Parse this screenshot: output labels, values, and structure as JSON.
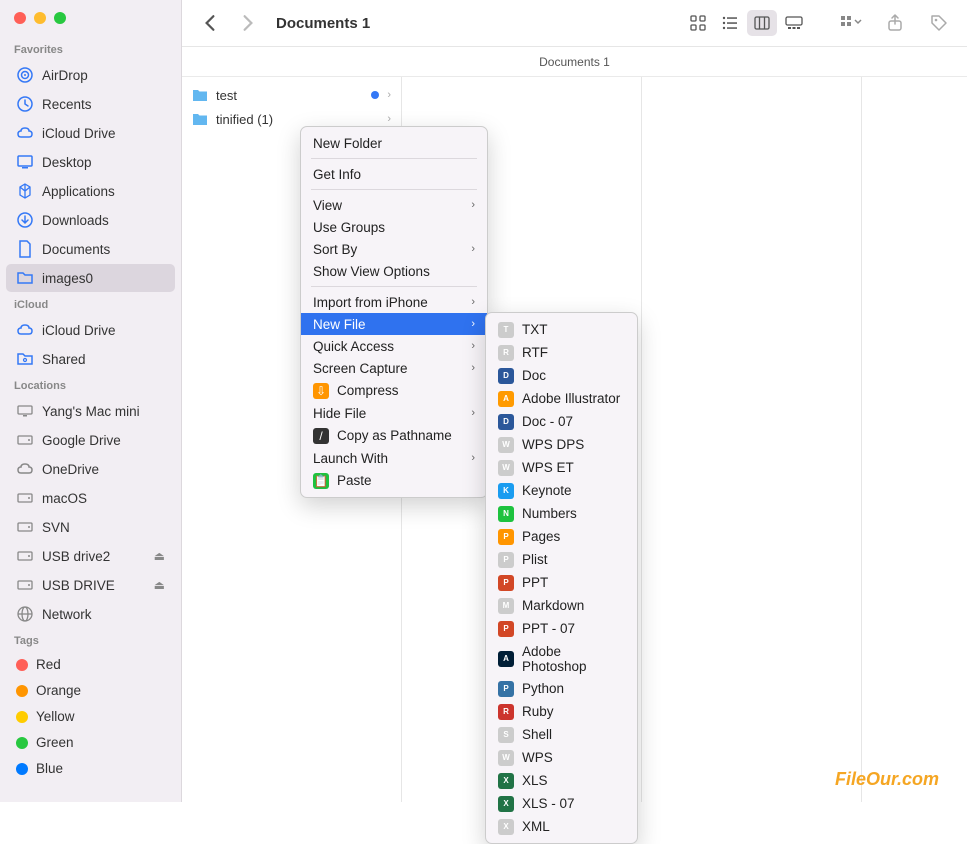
{
  "toolbar": {
    "title": "Documents 1"
  },
  "pathbar": {
    "current": "Documents 1"
  },
  "sidebar": {
    "sections": [
      {
        "title": "Favorites",
        "items": [
          {
            "label": "AirDrop",
            "icon": "airdrop"
          },
          {
            "label": "Recents",
            "icon": "clock"
          },
          {
            "label": "iCloud Drive",
            "icon": "cloud"
          },
          {
            "label": "Desktop",
            "icon": "desktop"
          },
          {
            "label": "Applications",
            "icon": "apps"
          },
          {
            "label": "Downloads",
            "icon": "download"
          },
          {
            "label": "Documents",
            "icon": "document"
          },
          {
            "label": "images0",
            "icon": "folder",
            "selected": true
          }
        ]
      },
      {
        "title": "iCloud",
        "items": [
          {
            "label": "iCloud Drive",
            "icon": "cloud"
          },
          {
            "label": "Shared",
            "icon": "shared"
          }
        ]
      },
      {
        "title": "Locations",
        "items": [
          {
            "label": "Yang's Mac mini",
            "icon": "computer",
            "gray": true
          },
          {
            "label": "Google Drive",
            "icon": "disk",
            "gray": true
          },
          {
            "label": "OneDrive",
            "icon": "cloud",
            "gray": true
          },
          {
            "label": "macOS",
            "icon": "disk",
            "gray": true
          },
          {
            "label": "SVN",
            "icon": "disk",
            "gray": true
          },
          {
            "label": "USB drive2",
            "icon": "disk",
            "gray": true,
            "eject": true
          },
          {
            "label": "USB DRIVE",
            "icon": "disk",
            "gray": true,
            "eject": true
          },
          {
            "label": "Network",
            "icon": "network",
            "gray": true
          }
        ]
      },
      {
        "title": "Tags",
        "items": [
          {
            "label": "Red",
            "tag": "#ff5f57"
          },
          {
            "label": "Orange",
            "tag": "#ff9500"
          },
          {
            "label": "Yellow",
            "tag": "#ffcc00"
          },
          {
            "label": "Green",
            "tag": "#28c840"
          },
          {
            "label": "Blue",
            "tag": "#007aff"
          }
        ]
      }
    ]
  },
  "files": [
    {
      "name": "test",
      "badge": true,
      "chevron": true
    },
    {
      "name": "tinified (1)",
      "chevron": true
    }
  ],
  "contextMenu": [
    {
      "label": "New Folder"
    },
    {
      "sep": true
    },
    {
      "label": "Get Info"
    },
    {
      "sep": true
    },
    {
      "label": "View",
      "sub": true
    },
    {
      "label": "Use Groups"
    },
    {
      "label": "Sort By",
      "sub": true
    },
    {
      "label": "Show View Options"
    },
    {
      "sep": true
    },
    {
      "label": "Import from iPhone",
      "sub": true
    },
    {
      "label": "New File",
      "sub": true,
      "highlighted": true
    },
    {
      "label": "Quick Access",
      "sub": true
    },
    {
      "label": "Screen Capture",
      "sub": true
    },
    {
      "label": "Compress",
      "icon": "compress"
    },
    {
      "label": "Hide File",
      "sub": true
    },
    {
      "label": "Copy as Pathname",
      "icon": "pathname"
    },
    {
      "label": "Launch With",
      "sub": true
    },
    {
      "label": "Paste",
      "icon": "paste"
    }
  ],
  "subMenu": [
    {
      "label": "TXT",
      "color": "#ccc"
    },
    {
      "label": "RTF",
      "color": "#ccc"
    },
    {
      "label": "Doc",
      "color": "#2b579a"
    },
    {
      "label": "Adobe Illustrator",
      "color": "#ff9a00"
    },
    {
      "label": "Doc - 07",
      "color": "#2b579a"
    },
    {
      "label": "WPS DPS",
      "color": "#ccc"
    },
    {
      "label": "WPS ET",
      "color": "#ccc"
    },
    {
      "label": "Keynote",
      "color": "#1a9cf0"
    },
    {
      "label": "Numbers",
      "color": "#1ec23f"
    },
    {
      "label": "Pages",
      "color": "#ff9500"
    },
    {
      "label": "Plist",
      "color": "#ccc"
    },
    {
      "label": "PPT",
      "color": "#d24726"
    },
    {
      "label": "Markdown",
      "color": "#ccc"
    },
    {
      "label": "PPT - 07",
      "color": "#d24726"
    },
    {
      "label": "Adobe Photoshop",
      "color": "#001e36"
    },
    {
      "label": "Python",
      "color": "#3572a5"
    },
    {
      "label": "Ruby",
      "color": "#cc342d"
    },
    {
      "label": "Shell",
      "color": "#ccc"
    },
    {
      "label": "WPS",
      "color": "#ccc"
    },
    {
      "label": "XLS",
      "color": "#217346"
    },
    {
      "label": "XLS - 07",
      "color": "#217346"
    },
    {
      "label": "XML",
      "color": "#ccc"
    }
  ],
  "watermark": "FileOur.com"
}
